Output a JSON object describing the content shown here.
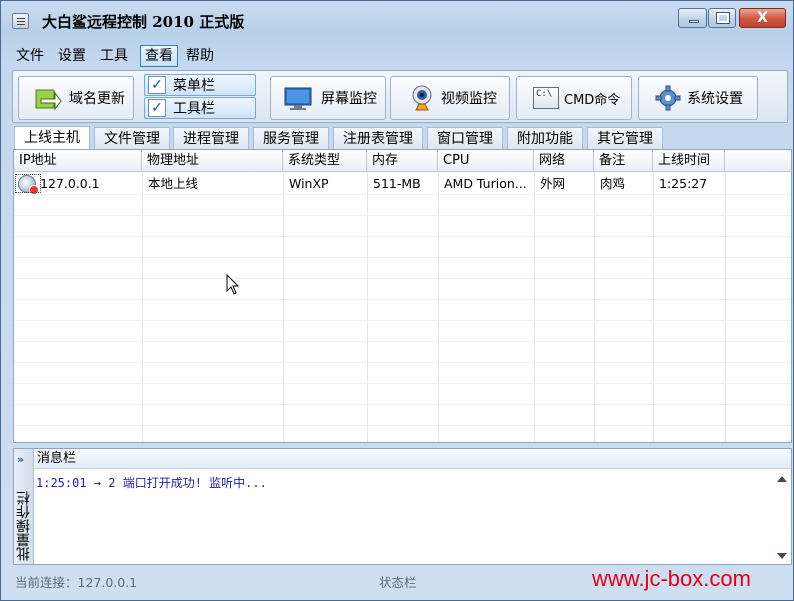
{
  "window": {
    "title": "大白鲨远程控制 2010 正式版",
    "close_label": "X"
  },
  "menu": [
    "文件",
    "设置",
    "工具",
    "查看",
    "帮助"
  ],
  "toolbar": {
    "domain_update": "域名更新",
    "menu_bar": "菜单栏",
    "tool_bar": "工具栏",
    "check_mark": "✓",
    "screen_monitor": "屏幕监控",
    "video_monitor": "视频监控",
    "cmd_icon_text": "C:\\",
    "cmd": "CMD命令",
    "system_settings": "系统设置"
  },
  "tabs": [
    "上线主机",
    "文件管理",
    "进程管理",
    "服务管理",
    "注册表管理",
    "窗口管理",
    "附加功能",
    "其它管理"
  ],
  "table": {
    "columns": [
      "IP地址",
      "物理地址",
      "系统类型",
      "内存",
      "CPU",
      "网络",
      "备注",
      "上线时间"
    ],
    "rows": [
      [
        "127.0.0.1",
        "本地上线",
        "WinXP",
        "511-MB",
        "AMD Turion...",
        "外网",
        "肉鸡",
        "1:25:27"
      ]
    ]
  },
  "message_panel": {
    "title": "消息栏",
    "side_label": "批量操作栏",
    "side_chevron": "»",
    "lines": [
      "1:25:01 → 2 端口打开成功! 监听中..."
    ]
  },
  "status": {
    "connection": "当前连接：127.0.0.1",
    "center": "状态栏"
  },
  "watermark": "www.jc-box.com",
  "colors": {
    "accent": "#3c7fb1",
    "message_text": "#22229c",
    "watermark": "#e0001a"
  },
  "icons": {
    "app": "app-menu-icon",
    "domain_update": "refresh-arrow-icon",
    "screen_monitor": "monitor-icon",
    "video_monitor": "webcam-icon",
    "cmd": "console-icon",
    "system_settings": "gear-icon",
    "row": "host-icon"
  }
}
